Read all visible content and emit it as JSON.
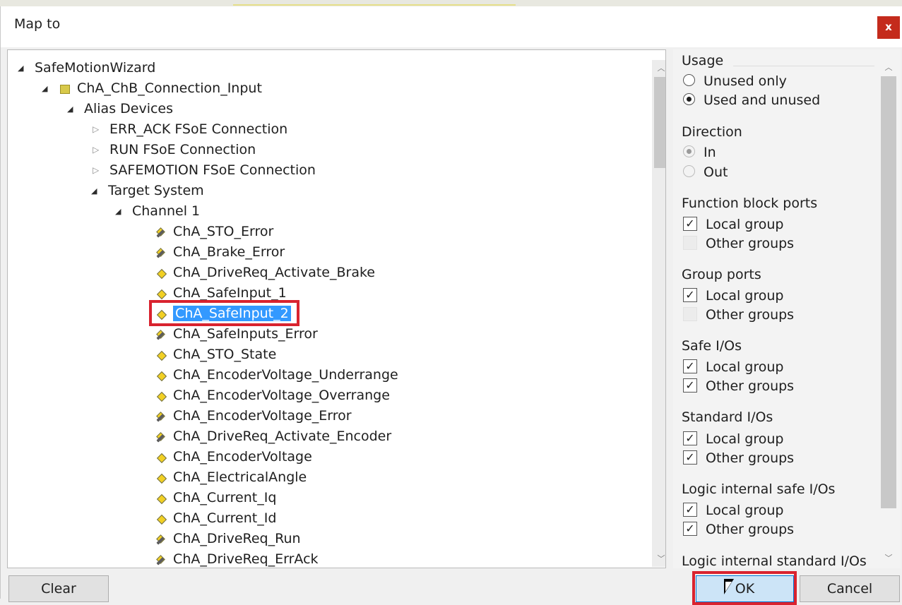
{
  "window": {
    "title": "Map to",
    "close_label": "x"
  },
  "tree": {
    "items": [
      {
        "label": "SafeMotionWizard",
        "expander": "◢",
        "icon": "none"
      },
      {
        "label": "ChA_ChB_Connection_Input",
        "expander": "◢",
        "icon": "group-icon"
      },
      {
        "label": "Alias Devices",
        "expander": "◢",
        "icon": "none"
      },
      {
        "label": "ERR_ACK FSoE Connection",
        "expander": "▷",
        "icon": "none"
      },
      {
        "label": "RUN FSoE Connection",
        "expander": "▷",
        "icon": "none"
      },
      {
        "label": "SAFEMOTION FSoE Connection",
        "expander": "▷",
        "icon": "none"
      },
      {
        "label": "Target System",
        "expander": "◢",
        "icon": "none"
      },
      {
        "label": "Channel 1",
        "expander": "◢",
        "icon": "none"
      },
      {
        "label": "ChA_STO_Error",
        "icon": "output-variable-icon"
      },
      {
        "label": "ChA_Brake_Error",
        "icon": "output-variable-icon"
      },
      {
        "label": "ChA_DriveReq_Activate_Brake",
        "icon": "input-variable-icon"
      },
      {
        "label": "ChA_SafeInput_1",
        "icon": "input-variable-icon"
      },
      {
        "label": "ChA_SafeInput_2",
        "icon": "input-variable-icon",
        "selected": true
      },
      {
        "label": "ChA_SafeInputs_Error",
        "icon": "output-variable-icon"
      },
      {
        "label": "ChA_STO_State",
        "icon": "input-variable-icon"
      },
      {
        "label": "ChA_EncoderVoltage_Underrange",
        "icon": "input-variable-icon"
      },
      {
        "label": "ChA_EncoderVoltage_Overrange",
        "icon": "input-variable-icon"
      },
      {
        "label": "ChA_EncoderVoltage_Error",
        "icon": "output-variable-icon"
      },
      {
        "label": "ChA_DriveReq_Activate_Encoder",
        "icon": "output-variable-icon"
      },
      {
        "label": "ChA_EncoderVoltage",
        "icon": "input-variable-icon"
      },
      {
        "label": "ChA_ElectricalAngle",
        "icon": "input-variable-icon"
      },
      {
        "label": "ChA_Current_Iq",
        "icon": "input-variable-icon"
      },
      {
        "label": "ChA_Current_Id",
        "icon": "input-variable-icon"
      },
      {
        "label": "ChA_DriveReq_Run",
        "icon": "output-variable-icon"
      },
      {
        "label": "ChA_DriveReq_ErrAck",
        "icon": "output-variable-icon"
      }
    ]
  },
  "filters": {
    "usage": {
      "title": "Usage",
      "options": [
        {
          "label": "Unused only",
          "checked": false
        },
        {
          "label": "Used and unused",
          "checked": true
        }
      ]
    },
    "direction": {
      "title": "Direction",
      "options": [
        {
          "label": "In",
          "checked": true,
          "disabled": true
        },
        {
          "label": "Out",
          "checked": false,
          "disabled": true
        }
      ]
    },
    "function_block_ports": {
      "title": "Function block ports",
      "local": {
        "label": "Local group",
        "checked": true
      },
      "other": {
        "label": "Other groups",
        "checked": false
      }
    },
    "group_ports": {
      "title": "Group ports",
      "local": {
        "label": "Local group",
        "checked": true
      },
      "other": {
        "label": "Other groups",
        "checked": false
      }
    },
    "safe_ios": {
      "title": "Safe I/Os",
      "local": {
        "label": "Local group",
        "checked": true
      },
      "other": {
        "label": "Other groups",
        "checked": true
      }
    },
    "standard_ios": {
      "title": "Standard I/Os",
      "local": {
        "label": "Local group",
        "checked": true
      },
      "other": {
        "label": "Other groups",
        "checked": true
      }
    },
    "logic_internal_safe_ios": {
      "title": "Logic internal safe I/Os",
      "local": {
        "label": "Local group",
        "checked": true
      },
      "other": {
        "label": "Other groups",
        "checked": true
      }
    },
    "logic_internal_standard_ios": {
      "title": "Logic internal standard I/Os"
    }
  },
  "buttons": {
    "clear": "Clear",
    "ok": "OK",
    "cancel": "Cancel"
  },
  "colors": {
    "selection": "#3399ff",
    "highlight_box": "#d9232f",
    "close_button": "#c42b1c",
    "ok_button": "#cce4f7"
  }
}
